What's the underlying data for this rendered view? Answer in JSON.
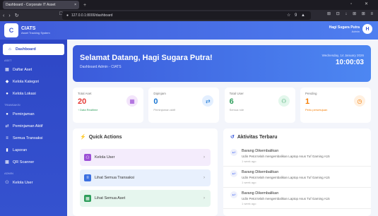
{
  "browser": {
    "tab_title": "Dashboard - Corporate IT Asset",
    "tab_close": "×",
    "tab_plus": "+",
    "window_controls": "▫ ✕",
    "url": "127.0.0.1:8000/dashboard",
    "url_icons": "☆ 9 ▲",
    "ext_icons": "⊞ ⊡ ↓ ⊞ ⊞ ≡"
  },
  "header": {
    "brand_logo": "C",
    "brand_name": "CIATS",
    "brand_sub": "Asset Tracking System",
    "user_name": "Hagi Sugara Putra",
    "user_role": "Admin",
    "avatar": "H"
  },
  "sidebar": {
    "dashboard": "Dashboard",
    "section_aset": "ASET",
    "daftar_aset": "Daftar Aset",
    "kelola_kategori": "Kelola Kategori",
    "kelola_lokasi": "Kelola Lokasi",
    "section_transaksi": "TRANSAKSI",
    "peminjaman": "Peminjaman",
    "peminjaman_aktif": "Peminjaman Aktif",
    "semua_transaksi": "Semua Transaksi",
    "laporan": "Laporan",
    "qr_scanner": "QR Scanner",
    "section_admin": "ADMIN",
    "kelola_user": "Kelola User"
  },
  "welcome": {
    "title": "Selamat Datang, Hagi Sugara Putra!",
    "subtitle": "Dashboard Admin - CIATS",
    "date": "Wednesday, 14 January 2026",
    "time": "10:00:03"
  },
  "stats": {
    "total_aset": {
      "label": "Total Aset",
      "value": "20",
      "note": "↑ Data Realtime"
    },
    "dipinjam": {
      "label": "Dipinjam",
      "value": "0",
      "note": "Peminjaman aktif"
    },
    "total_user": {
      "label": "Total User",
      "value": "6",
      "note": "Semua role"
    },
    "pending": {
      "label": "Pending",
      "value": "1",
      "note": "Perlu persetujuan"
    }
  },
  "quick_actions": {
    "title": "Quick Actions",
    "items": [
      {
        "label": "Kelola User"
      },
      {
        "label": "Lihat Semua Transaksi"
      },
      {
        "label": "Lihat Semua Aset"
      }
    ]
  },
  "activity": {
    "title": "Aktivitas Terbaru",
    "items": [
      {
        "title": "Barang Dikembalikan",
        "desc": "Udin Petot telah mengembalikan Laptop Asus Tuf Gaming A15",
        "time": "1 week ago"
      },
      {
        "title": "Barang Dikembalikan",
        "desc": "Udin Petot telah mengembalikan Laptop Asus Tuf Gaming A15",
        "time": "1 week ago"
      },
      {
        "title": "Barang Dikembalikan",
        "desc": "Udin Petot telah mengembalikan Laptop Asus Tuf Gaming A15",
        "time": "1 week ago"
      }
    ]
  },
  "colors": {
    "primary": "#3b5bdb",
    "sidebar": "#2e47c6",
    "accent_red": "#e53935",
    "accent_blue": "#1976d2",
    "accent_green": "#2e9e5b",
    "accent_orange": "#f57c00",
    "accent_purple": "#9c4fd6"
  }
}
